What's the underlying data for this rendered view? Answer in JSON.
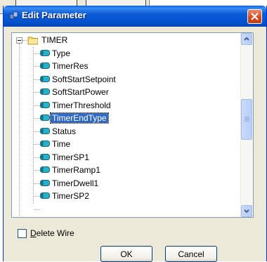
{
  "window": {
    "title": "Edit Parameter"
  },
  "tree": {
    "root": {
      "label": "TIMER",
      "icon": "folder-icon",
      "expander": "minus"
    },
    "items": [
      {
        "label": "Type",
        "icon": "parameter-icon",
        "selected": false
      },
      {
        "label": "TimerRes",
        "icon": "parameter-icon",
        "selected": false
      },
      {
        "label": "SoftStartSetpoint",
        "icon": "parameter-icon",
        "selected": false
      },
      {
        "label": "SoftStartPower",
        "icon": "parameter-icon",
        "selected": false
      },
      {
        "label": "TimerThreshold",
        "icon": "parameter-icon",
        "selected": false
      },
      {
        "label": "TimerEndType",
        "icon": "parameter-icon",
        "selected": true
      },
      {
        "label": "Status",
        "icon": "parameter-icon",
        "selected": false
      },
      {
        "label": "Time",
        "icon": "parameter-icon",
        "selected": false
      },
      {
        "label": "TimerSP1",
        "icon": "parameter-icon",
        "selected": false
      },
      {
        "label": "TimerRamp1",
        "icon": "parameter-icon",
        "selected": false
      },
      {
        "label": "TimerDwell1",
        "icon": "parameter-icon",
        "selected": false
      },
      {
        "label": "TimerSP2",
        "icon": "parameter-icon",
        "selected": false
      }
    ]
  },
  "checkbox": {
    "label": "Delete Wire",
    "accelerator": "D",
    "label_rest": "elete Wire",
    "checked": false
  },
  "buttons": {
    "ok": "OK",
    "cancel": "Cancel"
  },
  "colors": {
    "titlebar": "#0553d0",
    "selection": "#316ac5",
    "close": "#d6471f",
    "dialog_bg": "#ece9d8"
  }
}
